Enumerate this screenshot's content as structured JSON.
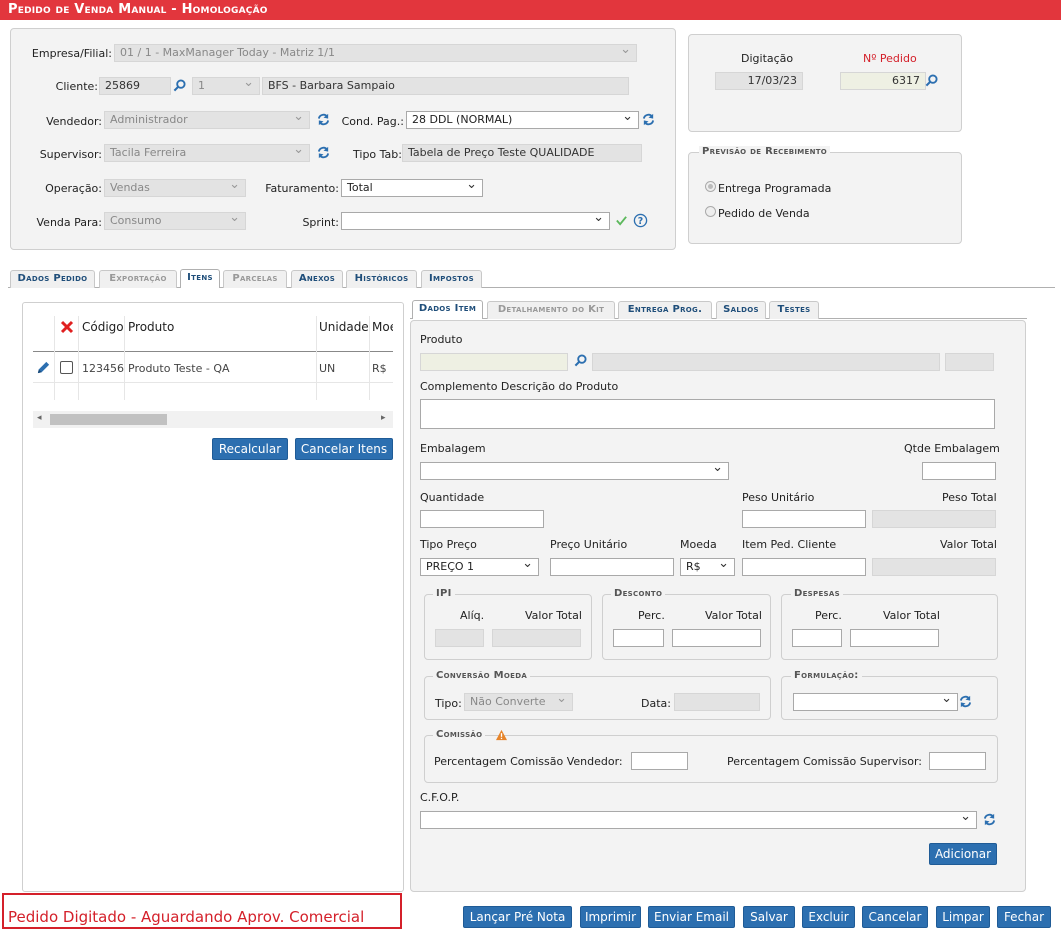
{
  "window": {
    "title": "Pedido de Venda Manual  - Homologação"
  },
  "header": {
    "empresa_label": "Empresa/Filial:",
    "empresa_value": "01 / 1 - MaxManager Today - Matriz 1/1",
    "cliente_label": "Cliente:",
    "cliente_code": "25869",
    "cliente_seq": "1",
    "cliente_name": "BFS - Barbara Sampaio",
    "vendedor_label": "Vendedor:",
    "vendedor_value": "Administrador",
    "cond_pag_label": "Cond. Pag.:",
    "cond_pag_value": "28 DDL (NORMAL)",
    "supervisor_label": "Supervisor:",
    "supervisor_value": "Tacila Ferreira",
    "tipo_tab_label": "Tipo Tab:",
    "tipo_tab_value": "Tabela de Preço Teste QUALIDADE",
    "operacao_label": "Operação:",
    "operacao_value": "Vendas",
    "faturamento_label": "Faturamento:",
    "faturamento_value": "Total",
    "venda_para_label": "Venda Para:",
    "venda_para_value": "Consumo",
    "sprint_label": "Sprint:",
    "sprint_value": ""
  },
  "digitacao": {
    "digitacao_label": "Digitação",
    "digitacao_value": "17/03/23",
    "pedido_label": "Nº Pedido",
    "pedido_value": "6317"
  },
  "previsao": {
    "legend": "Previsão de Recebimento",
    "option1": "Entrega Programada",
    "option2": "Pedido de Venda"
  },
  "main_tabs": [
    "Dados Pedido",
    "Exportação",
    "Itens",
    "Parcelas",
    "Anexos",
    "Históricos",
    "Impostos"
  ],
  "items_table": {
    "columns": [
      "Código",
      "Produto",
      "Unidade",
      "Moe"
    ],
    "rows": [
      {
        "codigo": "123456",
        "produto": "Produto Teste - QA",
        "unidade": "UN",
        "moeda": "R$"
      }
    ],
    "recalcular": "Recalcular",
    "cancelar_itens": "Cancelar Itens"
  },
  "item_tabs": [
    "Dados Item",
    "Detalhamento do Kit",
    "Entrega Prog.",
    "Saldos",
    "Testes"
  ],
  "item_form": {
    "produto_label": "Produto",
    "complemento_label": "Complemento Descrição do Produto",
    "embalagem_label": "Embalagem",
    "qtde_embalagem_label": "Qtde Embalagem",
    "quantidade_label": "Quantidade",
    "peso_unitario_label": "Peso Unitário",
    "peso_total_label": "Peso Total",
    "tipo_preco_label": "Tipo Preço",
    "tipo_preco_value": "PREÇO 1",
    "preco_unitario_label": "Preço Unitário",
    "moeda_label": "Moeda",
    "moeda_value": "R$",
    "item_ped_cliente_label": "Item Ped. Cliente",
    "valor_total_label": "Valor Total",
    "ipi_legend": "IPI",
    "ipi_aliq": "Alíq.",
    "ipi_valor_total": "Valor Total",
    "desconto_legend": "Desconto",
    "desconto_perc": "Perc.",
    "desconto_valor_total": "Valor Total",
    "despesas_legend": "Despesas",
    "despesas_perc": "Perc.",
    "despesas_valor_total": "Valor Total",
    "conversao_legend": "Conversão Moeda",
    "tipo_label": "Tipo:",
    "tipo_value": "Não Converte",
    "data_label": "Data:",
    "formulacao_legend": "Formulação:",
    "comissao_legend": "Comissão",
    "comissao_vendedor_label": "Percentagem Comissão Vendedor:",
    "comissao_supervisor_label": "Percentagem Comissão Supervisor:",
    "cfop_label": "C.F.O.P.",
    "adicionar": "Adicionar"
  },
  "status": {
    "text": "Pedido Digitado - Aguardando Aprov. Comercial"
  },
  "footer_buttons": [
    "Lançar Pré Nota",
    "Imprimir",
    "Enviar Email",
    "Salvar",
    "Excluir",
    "Cancelar",
    "Limpar",
    "Fechar"
  ],
  "colors": {
    "titlebar": "#e2363d",
    "button": "#2c6fb0",
    "tab_text": "#1f4e7a",
    "status_text": "#d4202a",
    "pedido_label": "#d4202a"
  }
}
